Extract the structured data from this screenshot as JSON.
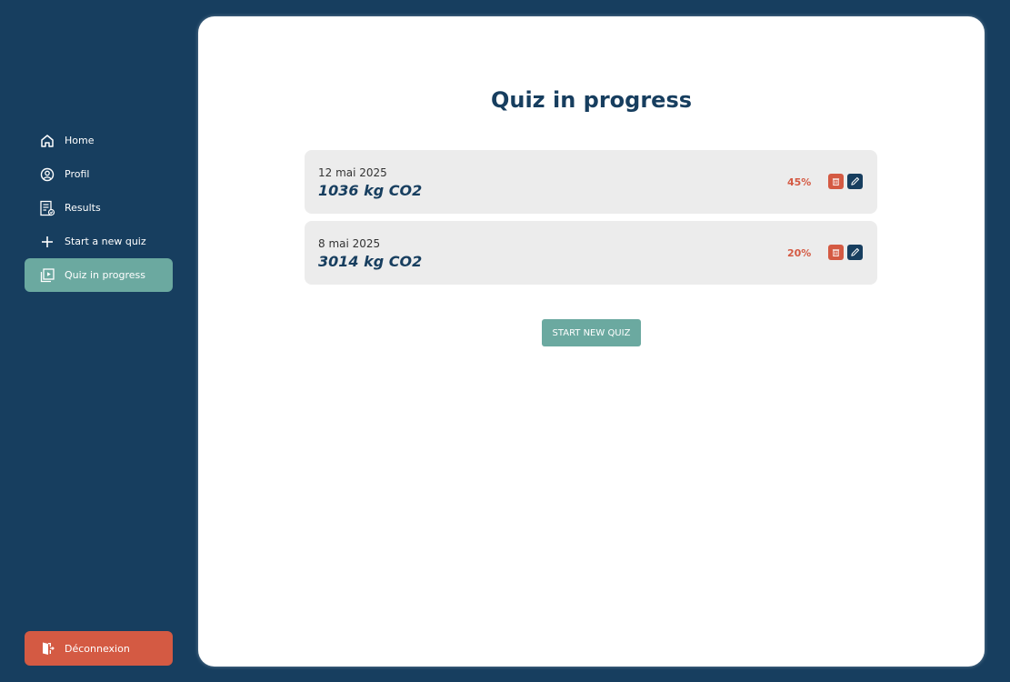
{
  "sidebar": {
    "items": [
      {
        "label": "Home",
        "icon": "home-icon"
      },
      {
        "label": "Profil",
        "icon": "user-circle-icon"
      },
      {
        "label": "Results",
        "icon": "report-icon"
      },
      {
        "label": "Start a new quiz",
        "icon": "plus-icon"
      },
      {
        "label": "Quiz in progress",
        "icon": "play-stack-icon",
        "active": true
      }
    ],
    "logout_label": "Déconnexion"
  },
  "main": {
    "title": "Quiz in progress",
    "quizzes": [
      {
        "date": "12 mai 2025",
        "value": "1036 kg CO2",
        "progress": "45%"
      },
      {
        "date": "8 mai 2025",
        "value": "3014 kg CO2",
        "progress": "20%"
      }
    ],
    "start_button": "START NEW QUIZ"
  },
  "colors": {
    "background": "#173e5f",
    "accent": "#6ba9a0",
    "danger": "#d45a43"
  }
}
